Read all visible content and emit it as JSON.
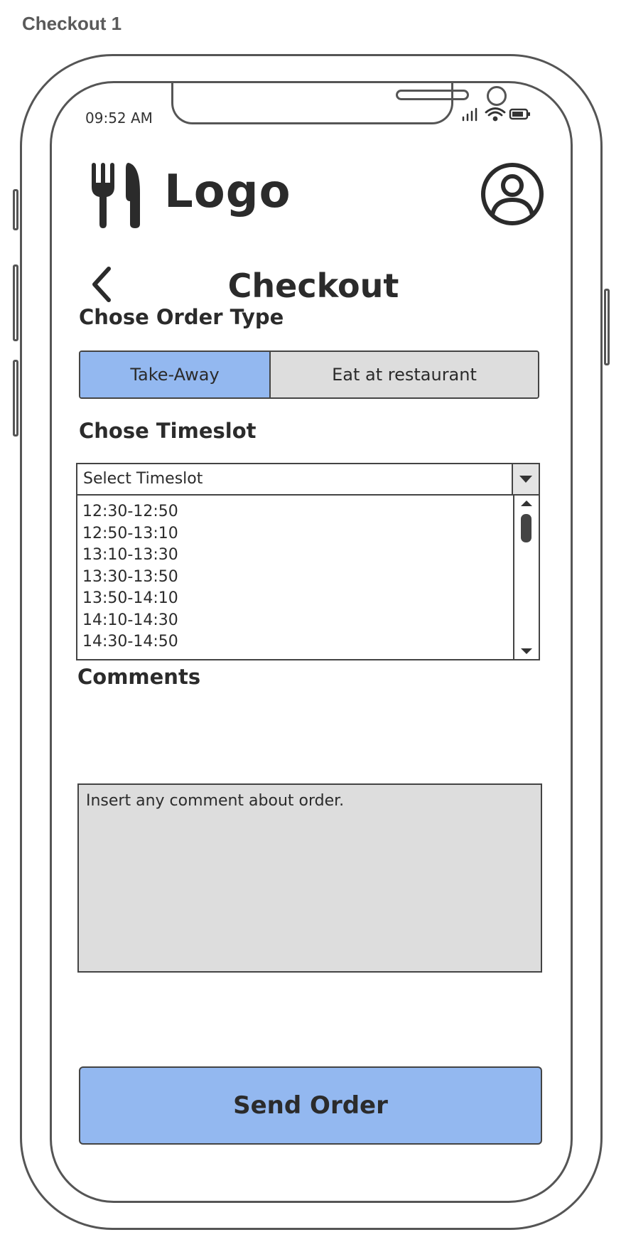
{
  "frame": {
    "title": "Checkout 1"
  },
  "status_bar": {
    "time": "09:52 AM",
    "icons": [
      "signal-icon",
      "wifi-icon",
      "battery-icon"
    ]
  },
  "header": {
    "logo_text": "Logo",
    "logo_icon": "fork-knife-icon",
    "profile_icon": "user-avatar-icon"
  },
  "page": {
    "title": "Checkout",
    "back_icon": "chevron-left-icon"
  },
  "order_type": {
    "label": "Chose Order Type",
    "options": [
      {
        "label": "Take-Away",
        "selected": true
      },
      {
        "label": "Eat at restaurant",
        "selected": false
      }
    ]
  },
  "timeslot": {
    "label": "Chose Timeslot",
    "select_value": "Select Timeslot",
    "options": [
      "12:30-12:50",
      "12:50-13:10",
      "13:10-13:30",
      "13:30-13:50",
      "13:50-14:10",
      "14:10-14:30",
      "14:30-14:50"
    ]
  },
  "comments": {
    "label": "Comments",
    "placeholder": "Insert any comment about order."
  },
  "actions": {
    "send_label": "Send Order"
  },
  "colors": {
    "accent": "#93b8f0",
    "inactive": "#dddddd",
    "outline": "#444444",
    "text": "#2b2b2b"
  }
}
